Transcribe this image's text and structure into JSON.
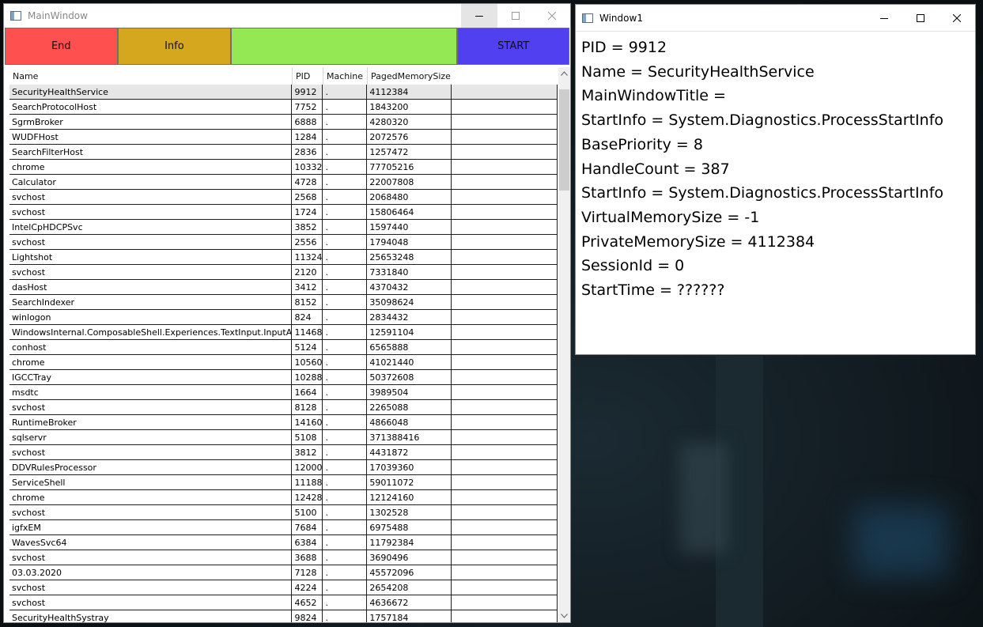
{
  "main_window": {
    "title": "MainWindow",
    "toolbar": {
      "end_label": "End",
      "info_label": "Info",
      "blank_label": "",
      "start_label": "START",
      "colors": {
        "end": "#ff5050",
        "info": "#d4a71e",
        "blank": "#94e854",
        "start": "#5040f0"
      }
    },
    "grid": {
      "columns": [
        "Name",
        "PID",
        "Machine",
        "PagedMemorySize"
      ],
      "rows": [
        [
          "SecurityHealthService",
          "9912",
          ".",
          "4112384"
        ],
        [
          "SearchProtocolHost",
          "7752",
          ".",
          "1843200"
        ],
        [
          "SgrmBroker",
          "6888",
          ".",
          "4280320"
        ],
        [
          "WUDFHost",
          "1284",
          ".",
          "2072576"
        ],
        [
          "SearchFilterHost",
          "2836",
          ".",
          "1257472"
        ],
        [
          "chrome",
          "10332",
          ".",
          "77705216"
        ],
        [
          "Calculator",
          "4728",
          ".",
          "22007808"
        ],
        [
          "svchost",
          "2568",
          ".",
          "2068480"
        ],
        [
          "svchost",
          "1724",
          ".",
          "15806464"
        ],
        [
          "IntelCpHDCPSvc",
          "3852",
          ".",
          "1597440"
        ],
        [
          "svchost",
          "2556",
          ".",
          "1794048"
        ],
        [
          "Lightshot",
          "11324",
          ".",
          "25653248"
        ],
        [
          "svchost",
          "2120",
          ".",
          "7331840"
        ],
        [
          "dasHost",
          "3412",
          ".",
          "4370432"
        ],
        [
          "SearchIndexer",
          "8152",
          ".",
          "35098624"
        ],
        [
          "winlogon",
          "824",
          ".",
          "2834432"
        ],
        [
          "WindowsInternal.ComposableShell.Experiences.TextInput.InputApp",
          "11468",
          ".",
          "12591104"
        ],
        [
          "conhost",
          "5124",
          ".",
          "6565888"
        ],
        [
          "chrome",
          "10560",
          ".",
          "41021440"
        ],
        [
          "IGCCTray",
          "10288",
          ".",
          "50372608"
        ],
        [
          "msdtc",
          "1664",
          ".",
          "3989504"
        ],
        [
          "svchost",
          "8128",
          ".",
          "2265088"
        ],
        [
          "RuntimeBroker",
          "14160",
          ".",
          "4866048"
        ],
        [
          "sqlservr",
          "5108",
          ".",
          "371388416"
        ],
        [
          "svchost",
          "3812",
          ".",
          "4431872"
        ],
        [
          "DDVRulesProcessor",
          "12000",
          ".",
          "17039360"
        ],
        [
          "ServiceShell",
          "11188",
          ".",
          "59011072"
        ],
        [
          "chrome",
          "12428",
          ".",
          "12124160"
        ],
        [
          "svchost",
          "5100",
          ".",
          "1302528"
        ],
        [
          "igfxEM",
          "7684",
          ".",
          "6975488"
        ],
        [
          "WavesSvc64",
          "6384",
          ".",
          "11792384"
        ],
        [
          "svchost",
          "3688",
          ".",
          "3690496"
        ],
        [
          "03.03.2020",
          "7128",
          ".",
          "45572096"
        ],
        [
          "svchost",
          "4224",
          ".",
          "2654208"
        ],
        [
          "svchost",
          "4652",
          ".",
          "4636672"
        ],
        [
          "SecurityHealthSystray",
          "9824",
          ".",
          "1757184"
        ]
      ],
      "selected_row": 0
    }
  },
  "info_window": {
    "title": "Window1",
    "lines": [
      "PID = 9912",
      "Name = SecurityHealthService",
      "MainWindowTitle =",
      "StartInfo = System.Diagnostics.ProcessStartInfo",
      "BasePriority = 8",
      "HandleCount = 387",
      "StartInfo = System.Diagnostics.ProcessStartInfo",
      "VirtualMemorySize = -1",
      "PrivateMemorySize = 4112384",
      "SessionId = 0",
      "StartTime = ??????"
    ]
  }
}
